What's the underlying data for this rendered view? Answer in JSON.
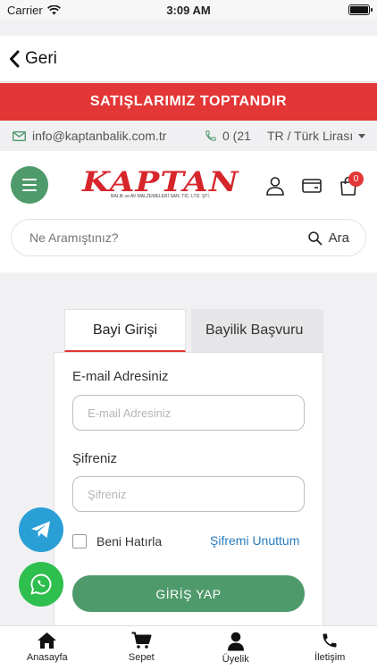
{
  "status_bar": {
    "carrier": "Carrier",
    "time": "3:09 AM"
  },
  "nav": {
    "back_label": "Geri"
  },
  "banner": {
    "text": "SATIŞLARIMIZ TOPTANDIR",
    "color": "#e33636"
  },
  "contact": {
    "email": "info@kaptanbalik.com.tr",
    "phone": "0 (21",
    "locale": "TR / Türk Lirası"
  },
  "header": {
    "logo_text": "KAPTAN",
    "logo_sub": "BALIK ve AV MALZEMELERİ SAN. TİC. LTD. ŞTİ.",
    "cart_count": "0"
  },
  "search": {
    "placeholder": "Ne Aramıştınız?",
    "button_label": "Ara"
  },
  "tabs": {
    "active": "Bayi Girişi",
    "inactive": "Bayilik Başvuru"
  },
  "form": {
    "email_label": "E-mail Adresiniz",
    "email_placeholder": "E-mail Adresiniz",
    "password_label": "Şifreniz",
    "password_placeholder": "Şifreniz",
    "remember_label": "Beni Hatırla",
    "forgot_label": "Şifremi Unuttum",
    "submit_label": "GİRİŞ YAP"
  },
  "fabs": {
    "telegram": "telegram-icon",
    "whatsapp": "whatsapp-icon"
  },
  "tabbar": {
    "items": [
      {
        "label": "Anasayfa",
        "icon": "home-icon"
      },
      {
        "label": "Sepet",
        "icon": "cart-icon"
      },
      {
        "label": "Üyelik",
        "icon": "user-icon"
      },
      {
        "label": "İletişim",
        "icon": "phone-icon"
      }
    ]
  },
  "colors": {
    "accent_green": "#4e9a6a",
    "accent_red": "#e33636",
    "link_blue": "#2a7cbd"
  }
}
